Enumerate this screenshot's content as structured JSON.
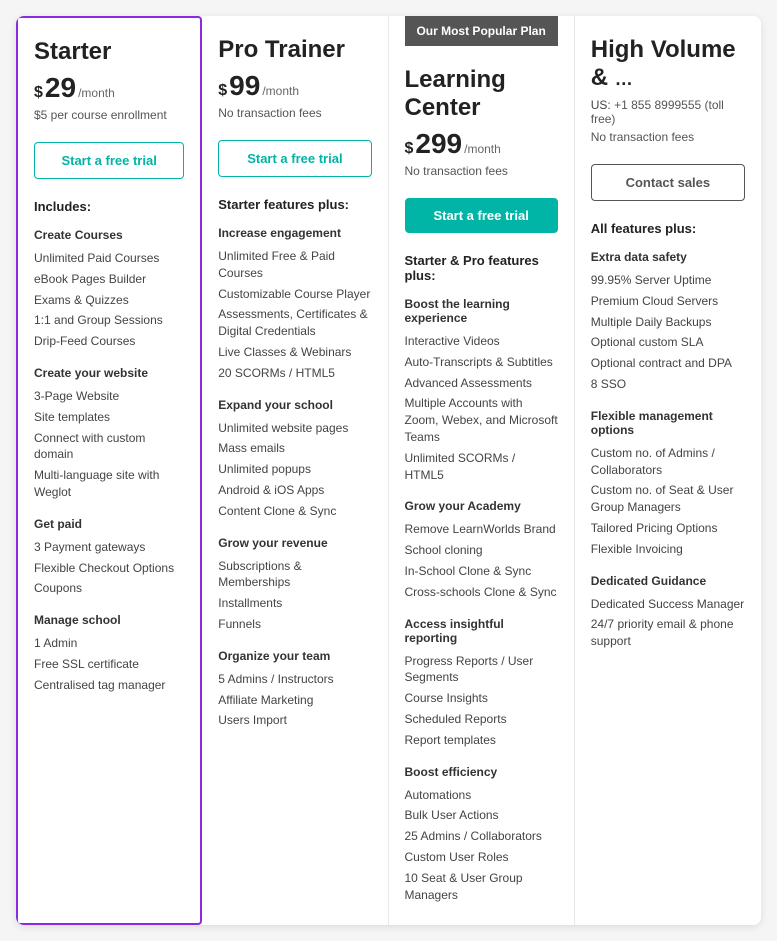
{
  "plans": [
    {
      "id": "starter",
      "name": "Starter",
      "currency": "$",
      "amount": "29",
      "period": "/month",
      "subtitle": "$5 per course enrollment",
      "cta_label": "Start a free trial",
      "cta_style": "outline-teal",
      "popular": false,
      "sections": [
        {
          "heading": "Includes:",
          "categories": [
            {
              "title": "Create Courses",
              "items": [
                "Unlimited Paid Courses",
                "eBook Pages Builder",
                "Exams & Quizzes",
                "1:1 and Group Sessions",
                "Drip-Feed Courses"
              ]
            },
            {
              "title": "Create your website",
              "items": [
                "3-Page Website",
                "Site templates",
                "Connect with custom domain",
                "Multi-language site with Weglot"
              ]
            },
            {
              "title": "Get paid",
              "items": [
                "3 Payment gateways",
                "Flexible Checkout Options",
                "Coupons"
              ]
            },
            {
              "title": "Manage school",
              "items": [
                "1 Admin",
                "Free SSL certificate",
                "Centralised tag manager"
              ]
            }
          ]
        }
      ]
    },
    {
      "id": "pro-trainer",
      "name": "Pro Trainer",
      "currency": "$",
      "amount": "99",
      "period": "/month",
      "subtitle": "No transaction fees",
      "cta_label": "Start a free trial",
      "cta_style": "outline-teal",
      "popular": false,
      "sections": [
        {
          "heading": "Starter features plus:",
          "categories": [
            {
              "title": "Increase engagement",
              "items": [
                "Unlimited Free & Paid Courses",
                "Customizable Course Player",
                "Assessments, Certificates & Digital Credentials",
                "Live Classes & Webinars",
                "20 SCORMs / HTML5"
              ]
            },
            {
              "title": "Expand your school",
              "items": [
                "Unlimited website pages",
                "Mass emails",
                "Unlimited popups",
                "Android & iOS Apps",
                "Content Clone & Sync"
              ]
            },
            {
              "title": "Grow your revenue",
              "items": [
                "Subscriptions & Memberships",
                "Installments",
                "Funnels"
              ]
            },
            {
              "title": "Organize your team",
              "items": [
                "5 Admins / Instructors",
                "Affiliate Marketing",
                "Users Import"
              ]
            }
          ]
        }
      ]
    },
    {
      "id": "learning-center",
      "name": "Learning Center",
      "currency": "$",
      "amount": "299",
      "period": "/month",
      "subtitle": "No transaction fees",
      "cta_label": "Start a free trial",
      "cta_style": "filled-teal",
      "popular": true,
      "popular_label": "Our Most Popular Plan",
      "sections": [
        {
          "heading": "Starter & Pro features plus:",
          "categories": [
            {
              "title": "Boost the learning experience",
              "items": [
                "Interactive Videos",
                "Auto-Transcripts & Subtitles",
                "Advanced Assessments",
                "Multiple Accounts with Zoom, Webex, and Microsoft Teams",
                "Unlimited SCORMs / HTML5"
              ]
            },
            {
              "title": "Grow your Academy",
              "items": [
                "Remove LearnWorlds Brand",
                "School cloning",
                "In-School Clone & Sync",
                "Cross-schools Clone & Sync"
              ]
            },
            {
              "title": "Access insightful reporting",
              "items": [
                "Progress Reports / User Segments",
                "Course Insights",
                "Scheduled Reports",
                "Report templates"
              ]
            },
            {
              "title": "Boost efficiency",
              "items": [
                "Automations",
                "Bulk User Actions",
                "25 Admins / Collaborators",
                "Custom User Roles",
                "10 Seat & User Group Managers"
              ]
            }
          ]
        }
      ]
    },
    {
      "id": "high-volume",
      "name": "High Volume &",
      "name_suffix": "…",
      "currency": "",
      "amount": "",
      "period": "",
      "subtitle": "No transaction fees",
      "phone_label": "US:",
      "phone": "+1 855 8999555 (toll free)",
      "cta_label": "Contact sales",
      "cta_style": "outline-dark",
      "popular": false,
      "sections": [
        {
          "heading": "All features plus:",
          "categories": [
            {
              "title": "Extra data safety",
              "items": [
                "99.95% Server Uptime",
                "Premium Cloud Servers",
                "Multiple Daily Backups",
                "Optional custom SLA",
                "Optional contract and DPA",
                "8 SSO"
              ]
            },
            {
              "title": "Flexible management options",
              "items": [
                "Custom no. of Admins / Collaborators",
                "Custom no. of Seat & User Group Managers",
                "Tailored Pricing Options",
                "Flexible Invoicing"
              ]
            },
            {
              "title": "Dedicated Guidance",
              "items": [
                "Dedicated Success Manager",
                "24/7 priority email & phone support"
              ]
            }
          ]
        }
      ]
    }
  ]
}
